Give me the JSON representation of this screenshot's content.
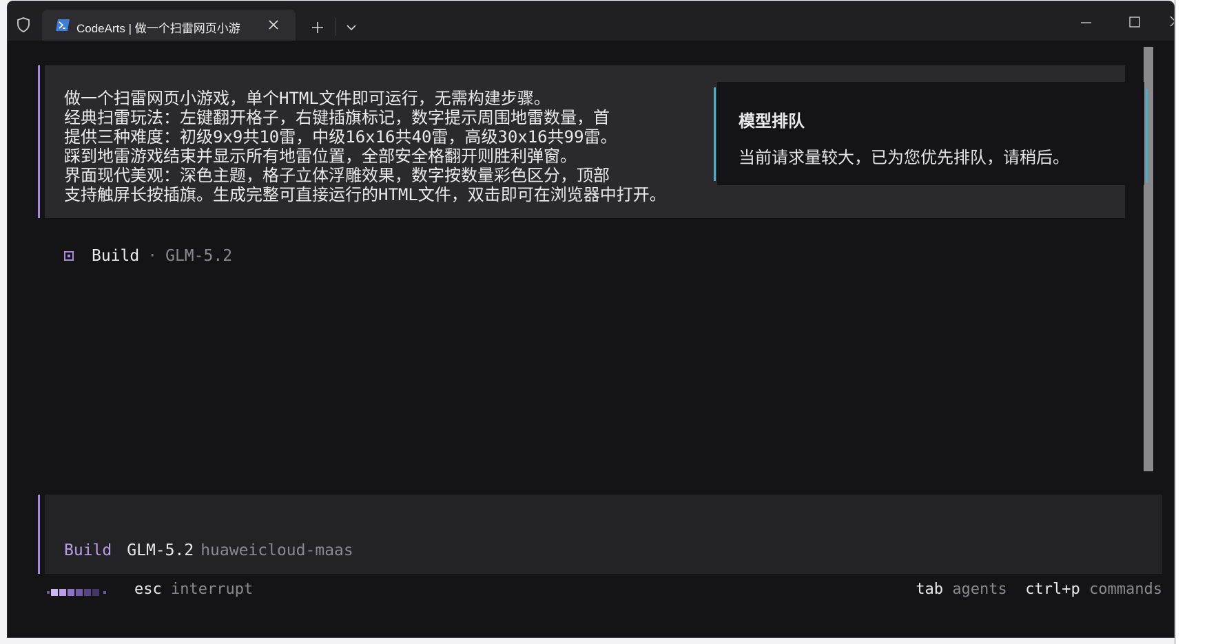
{
  "window": {
    "tab_title": "CodeArts | 做一个扫雷网页小游",
    "icons": {
      "shield": "shield-icon",
      "tab": "powershell-icon",
      "close": "close-icon",
      "new_tab": "plus-icon",
      "dropdown": "chevron-down-icon",
      "minimize": "minimize-icon",
      "maximize": "maximize-icon",
      "window_close": "close-icon"
    }
  },
  "conversation": {
    "user_message": "做一个扫雷网页小游戏，单个HTML文件即可运行，无需构建步骤。\n经典扫雷玩法：左键翻开格子，右键插旗标记，数字提示周围地雷数量，首\n提供三种难度：初级9x9共10雷，中级16x16共40雷，高级30x16共99雷。\n踩到地雷游戏结束并显示所有地雷位置，全部安全格翻开则胜利弹窗。\n界面现代美观：深色主题，格子立体浮雕效果，数字按数量彩色区分，顶部\n支持触屏长按插旗。生成完整可直接运行的HTML文件，双击即可在浏览器中打开。",
    "build_status": {
      "mode": "Build",
      "separator": "·",
      "model": "GLM-5.2"
    }
  },
  "queue_notice": {
    "title": "模型排队",
    "body": "当前请求量较大，已为您优先排队，请稍后。"
  },
  "prompt": {
    "mode": "Build",
    "model": "GLM-5.2",
    "provider": "huaweicloud-maas"
  },
  "hints": {
    "esc_key": "esc",
    "esc_desc": "interrupt",
    "tab_key": "tab",
    "tab_desc": "agents",
    "cmd_key": "ctrl+p",
    "cmd_desc": "commands"
  },
  "colors": {
    "accent_purple": "#a78bdb",
    "accent_cyan": "#4aaec9",
    "background": "#141417"
  }
}
